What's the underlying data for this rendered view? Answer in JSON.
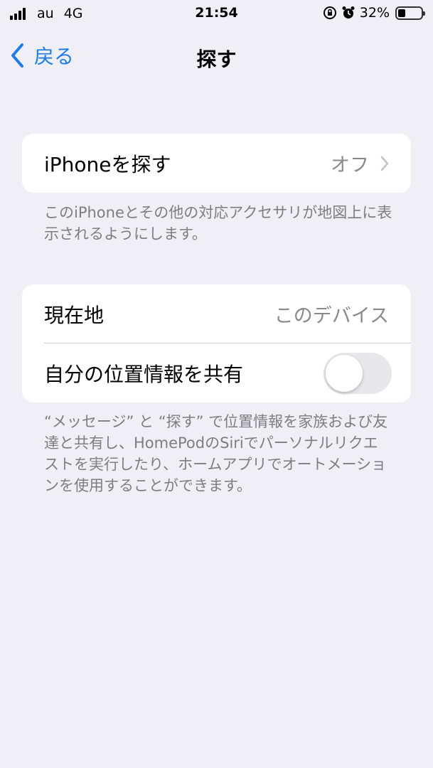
{
  "status_bar": {
    "carrier": "au",
    "network": "4G",
    "time": "21:54",
    "battery_percent_text": "32%",
    "battery_level": 0.32,
    "icons": [
      "signal-bars-icon",
      "orientation-lock-icon",
      "alarm-icon",
      "battery-icon"
    ]
  },
  "nav": {
    "back_label": "戻る",
    "title": "探す"
  },
  "find_iphone": {
    "label": "iPhoneを探す",
    "value": "オフ",
    "footer": "このiPhoneとその他の対応アクセサリが地図上に表示されるようにします。"
  },
  "location": {
    "current_label": "現在地",
    "current_value": "このデバイス",
    "share_label": "自分の位置情報を共有",
    "share_enabled": false,
    "footer": "“メッセージ” と “探す” で位置情報を家族および友達と共有し、HomePodのSiriでパーソナルリクエストを実行したり、ホームアプリでオートメーションを使用することができます。"
  },
  "colors": {
    "accent": "#1a7cf3",
    "background": "#f0eff6",
    "secondary_text": "#8a8a8e"
  }
}
